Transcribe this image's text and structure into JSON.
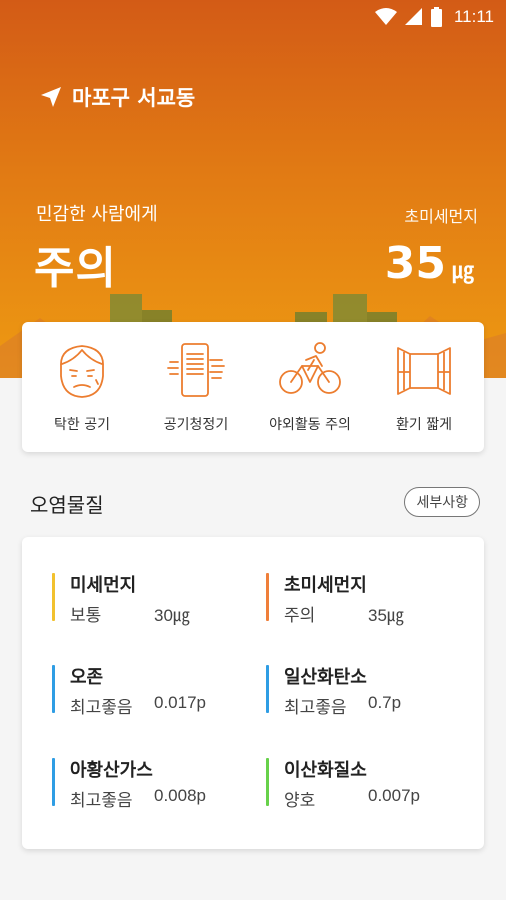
{
  "status_bar": {
    "time": "11:11"
  },
  "location": {
    "name": "마포구 서교동"
  },
  "summary": {
    "advice": "민감한 사람에게",
    "level": "주의",
    "pm_label": "초미세먼지",
    "pm_value": "35",
    "pm_unit": "㎍"
  },
  "colors": {
    "hero_top": "#d35b16",
    "hero_bottom": "#ee9a12",
    "icon_accent": "#ec7d2f",
    "moderate_yellow": "#f2c12e",
    "caution_orange": "#ef7f3a",
    "good_blue": "#2f9de4",
    "fair_green": "#67d14a"
  },
  "tips": [
    {
      "label": "탁한 공기",
      "icon": "face-icon"
    },
    {
      "label": "공기청정기",
      "icon": "air-purifier-icon"
    },
    {
      "label": "야외활동 주의",
      "icon": "bicycle-icon"
    },
    {
      "label": "환기 짧게",
      "icon": "window-icon"
    }
  ],
  "pollutants": {
    "title": "오염물질",
    "detail_button": "세부사항",
    "items": [
      {
        "name": "미세먼지",
        "status": "보통",
        "value": "30㎍",
        "color": "#f2c12e"
      },
      {
        "name": "초미세먼지",
        "status": "주의",
        "value": "35㎍",
        "color": "#ef7f3a"
      },
      {
        "name": "오존",
        "status": "최고좋음",
        "value": "0.017p",
        "color": "#2f9de4"
      },
      {
        "name": "일산화탄소",
        "status": "최고좋음",
        "value": "0.7p",
        "color": "#2f9de4"
      },
      {
        "name": "아황산가스",
        "status": "최고좋음",
        "value": "0.008p",
        "color": "#2f9de4"
      },
      {
        "name": "이산화질소",
        "status": "양호",
        "value": "0.007p",
        "color": "#67d14a"
      }
    ]
  }
}
